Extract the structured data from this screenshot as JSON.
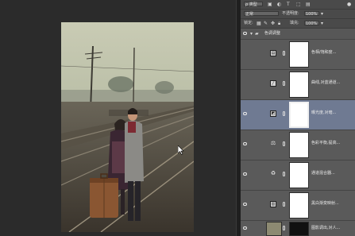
{
  "options_bar": {
    "filter_label": "ρ 类型",
    "blend_mode": "正常",
    "opacity_label": "不透明度:",
    "opacity_value": "100%",
    "lock_label": "锁定:",
    "fill_label": "填充:",
    "fill_value": "100%"
  },
  "group": {
    "name": "色调调整"
  },
  "layers": [
    {
      "name": "色相/饱和度...",
      "icon": "hue-saturation-icon",
      "visible": false,
      "selected": false
    },
    {
      "name": "曲线,对蓝通道...",
      "icon": "curves-icon",
      "visible": false,
      "selected": false
    },
    {
      "name": "曝光度,对暗...",
      "icon": "exposure-icon",
      "visible": true,
      "selected": true
    },
    {
      "name": "色彩平衡,提高...",
      "icon": "color-balance-icon",
      "visible": true,
      "selected": false
    },
    {
      "name": "通道混合器...",
      "icon": "channel-mixer-icon",
      "visible": true,
      "selected": false
    },
    {
      "name": "黑白渐变映射...",
      "icon": "gradient-map-icon",
      "visible": true,
      "selected": false
    },
    {
      "name": "图影调出,对人...",
      "icon": "photo-thumbnail-icon",
      "visible": true,
      "selected": false
    }
  ],
  "colors": {
    "panel_bg": "#535353",
    "selected_row": "#6f7a92",
    "canvas_bg": "#2b2b2b"
  }
}
